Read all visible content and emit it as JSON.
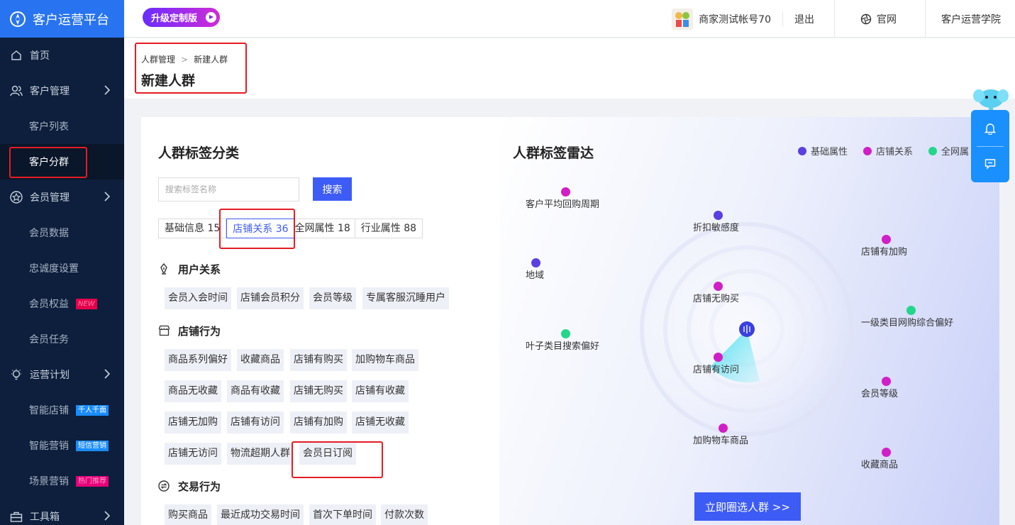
{
  "brand": {
    "title": "客户运营平台"
  },
  "sidebar": {
    "items": [
      {
        "label": "首页",
        "icon": "home-icon",
        "level": "top"
      },
      {
        "label": "客户管理",
        "icon": "users-icon",
        "level": "top",
        "expandable": true
      },
      {
        "label": "客户列表",
        "level": "sub"
      },
      {
        "label": "客户分群",
        "level": "sub",
        "active": true
      },
      {
        "label": "会员管理",
        "icon": "star-icon",
        "level": "top",
        "expandable": true
      },
      {
        "label": "会员数据",
        "level": "sub"
      },
      {
        "label": "忠诚度设置",
        "level": "sub"
      },
      {
        "label": "会员权益",
        "level": "sub",
        "badge": "NEW"
      },
      {
        "label": "会员任务",
        "level": "sub"
      },
      {
        "label": "运营计划",
        "icon": "bulb-icon",
        "level": "top",
        "expandable": true
      },
      {
        "label": "智能店铺",
        "level": "sub",
        "badge": "千人千面"
      },
      {
        "label": "智能营销",
        "level": "sub",
        "badge": "短信营销"
      },
      {
        "label": "场景营销",
        "level": "sub",
        "badge": "热门推荐"
      },
      {
        "label": "工具箱",
        "icon": "toolbox-icon",
        "level": "top",
        "expandable": true
      }
    ]
  },
  "header": {
    "upgrade_label": "升级定制版",
    "account": "商家测试帐号70",
    "logout": "退出",
    "official_site": "官网",
    "academy": "客户运营学院"
  },
  "breadcrumb": {
    "parent": "人群管理",
    "current": "新建人群",
    "separator": ">"
  },
  "page_title": "新建人群",
  "left_panel": {
    "title": "人群标签分类",
    "search_placeholder": "搜索标签名称",
    "search_button": "搜索",
    "tabs": [
      {
        "label": "基础信息 15"
      },
      {
        "label": "店铺关系 36",
        "active": true
      },
      {
        "label": "全网属性 18"
      },
      {
        "label": "行业属性 88"
      }
    ],
    "groups": [
      {
        "name": "用户关系",
        "icon": "pen-icon",
        "tags": [
          "会员入会时间",
          "店铺会员积分",
          "会员等级",
          "专属客服沉睡用户"
        ]
      },
      {
        "name": "店铺行为",
        "icon": "store-icon",
        "tags": [
          "商品系列偏好",
          "收藏商品",
          "店铺有购买",
          "加购物车商品",
          "商品无收藏",
          "商品有收藏",
          "店铺无购买",
          "店铺有收藏",
          "店铺无加购",
          "店铺有访问",
          "店铺有加购",
          "店铺无收藏",
          "店铺无访问",
          "物流超期人群",
          "会员日订阅"
        ]
      },
      {
        "name": "交易行为",
        "icon": "exchange-icon",
        "tags": [
          "购买商品",
          "最近成功交易时间",
          "首次下单时间",
          "付款次数"
        ]
      }
    ]
  },
  "radar": {
    "title": "人群标签雷达",
    "legend": [
      {
        "label": "基础属性",
        "color": "#5b3fe0"
      },
      {
        "label": "店铺关系",
        "color": "#d11fc7"
      },
      {
        "label": "全网属",
        "color": "#23d68a"
      }
    ],
    "points": [
      {
        "label": "客户平均回购周期",
        "category": "店铺关系"
      },
      {
        "label": "折扣敏感度",
        "category": "基础属性"
      },
      {
        "label": "店铺有加购",
        "category": "店铺关系"
      },
      {
        "label": "地域",
        "category": "基础属性"
      },
      {
        "label": "店铺无购买",
        "category": "店铺关系"
      },
      {
        "label": "一级类目网购综合偏好",
        "category": "全网属"
      },
      {
        "label": "叶子类目搜索偏好",
        "category": "全网属"
      },
      {
        "label": "店铺有访问",
        "category": "店铺关系"
      },
      {
        "label": "会员等级",
        "category": "店铺关系"
      },
      {
        "label": "加购物车商品",
        "category": "店铺关系"
      },
      {
        "label": "收藏商品",
        "category": "店铺关系"
      }
    ],
    "cta": "立即圈选人群 >>"
  },
  "colors": {
    "accent": "#3d5bf5",
    "sidebar_bg": "#0d1f3c",
    "brand_blue": "#2874f0",
    "highlight_red": "#e51c23"
  }
}
